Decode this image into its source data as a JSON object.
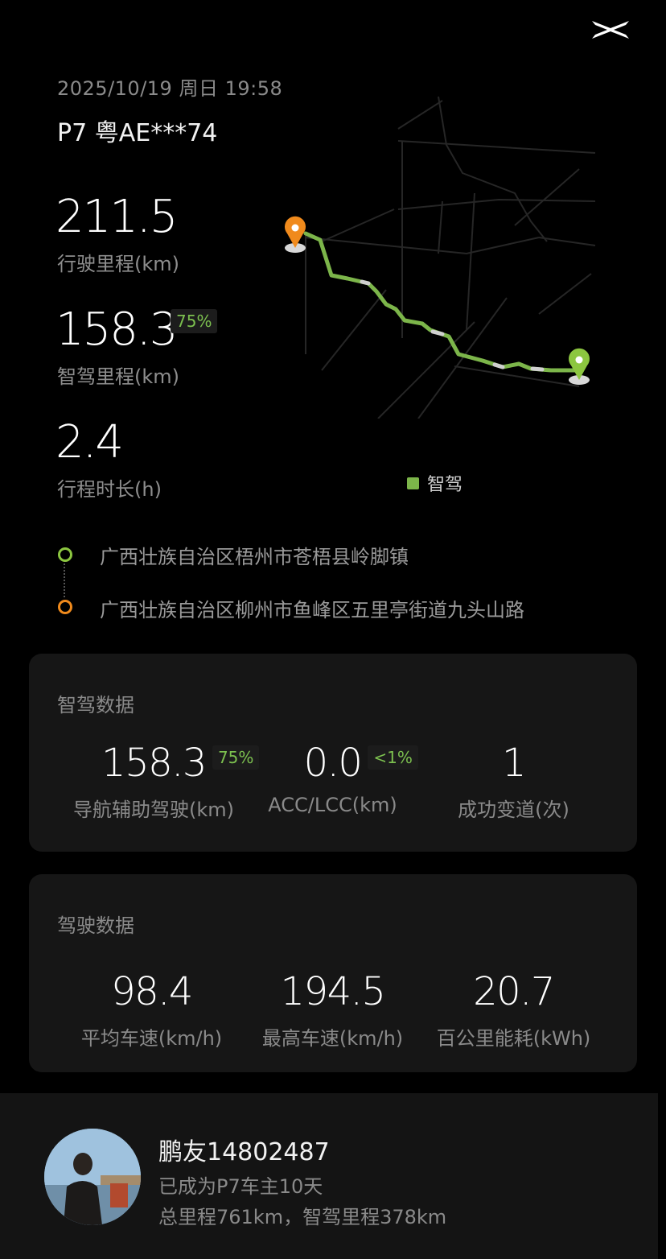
{
  "header": {
    "datetime": "2025/10/19 周日 19:58",
    "vehicle": "P7 粤AE***74"
  },
  "trip_stats": {
    "distance": {
      "value": "211.5",
      "label": "行驶里程(km)"
    },
    "smart_distance": {
      "value": "158.3",
      "percent": "75%",
      "label": "智驾里程(km)"
    },
    "duration": {
      "value": "2.4",
      "label": "行程时长(h)"
    }
  },
  "map": {
    "legend_label": "智驾",
    "route_color": "#7cb54a",
    "start_marker_color": "#f08a1c",
    "end_marker_color": "#8cc640"
  },
  "route": {
    "start_address": "广西壮族自治区梧州市苍梧县岭脚镇",
    "end_address": "广西壮族自治区柳州市鱼峰区五里亭街道九头山路",
    "start_dot_color": "#8cc640",
    "end_dot_color": "#f08a1c"
  },
  "smart_card": {
    "title": "智驾数据",
    "nav_assist": {
      "value": "158.3",
      "percent": "75%",
      "label": "导航辅助驾驶(km)"
    },
    "acc_lcc": {
      "value": "0.0",
      "percent": "<1%",
      "label": "ACC/LCC(km)"
    },
    "lane_change": {
      "value": "1",
      "label": "成功变道(次)"
    }
  },
  "drive_card": {
    "title": "驾驶数据",
    "avg_speed": {
      "value": "98.4",
      "label": "平均车速(km/h)"
    },
    "max_speed": {
      "value": "194.5",
      "label": "最高车速(km/h)"
    },
    "energy": {
      "value": "20.7",
      "label": "百公里能耗(kWh)"
    }
  },
  "user": {
    "name": "鹏友14802487",
    "owner_days": "已成为P7车主10天",
    "totals": "总里程761km，智驾里程378km"
  }
}
